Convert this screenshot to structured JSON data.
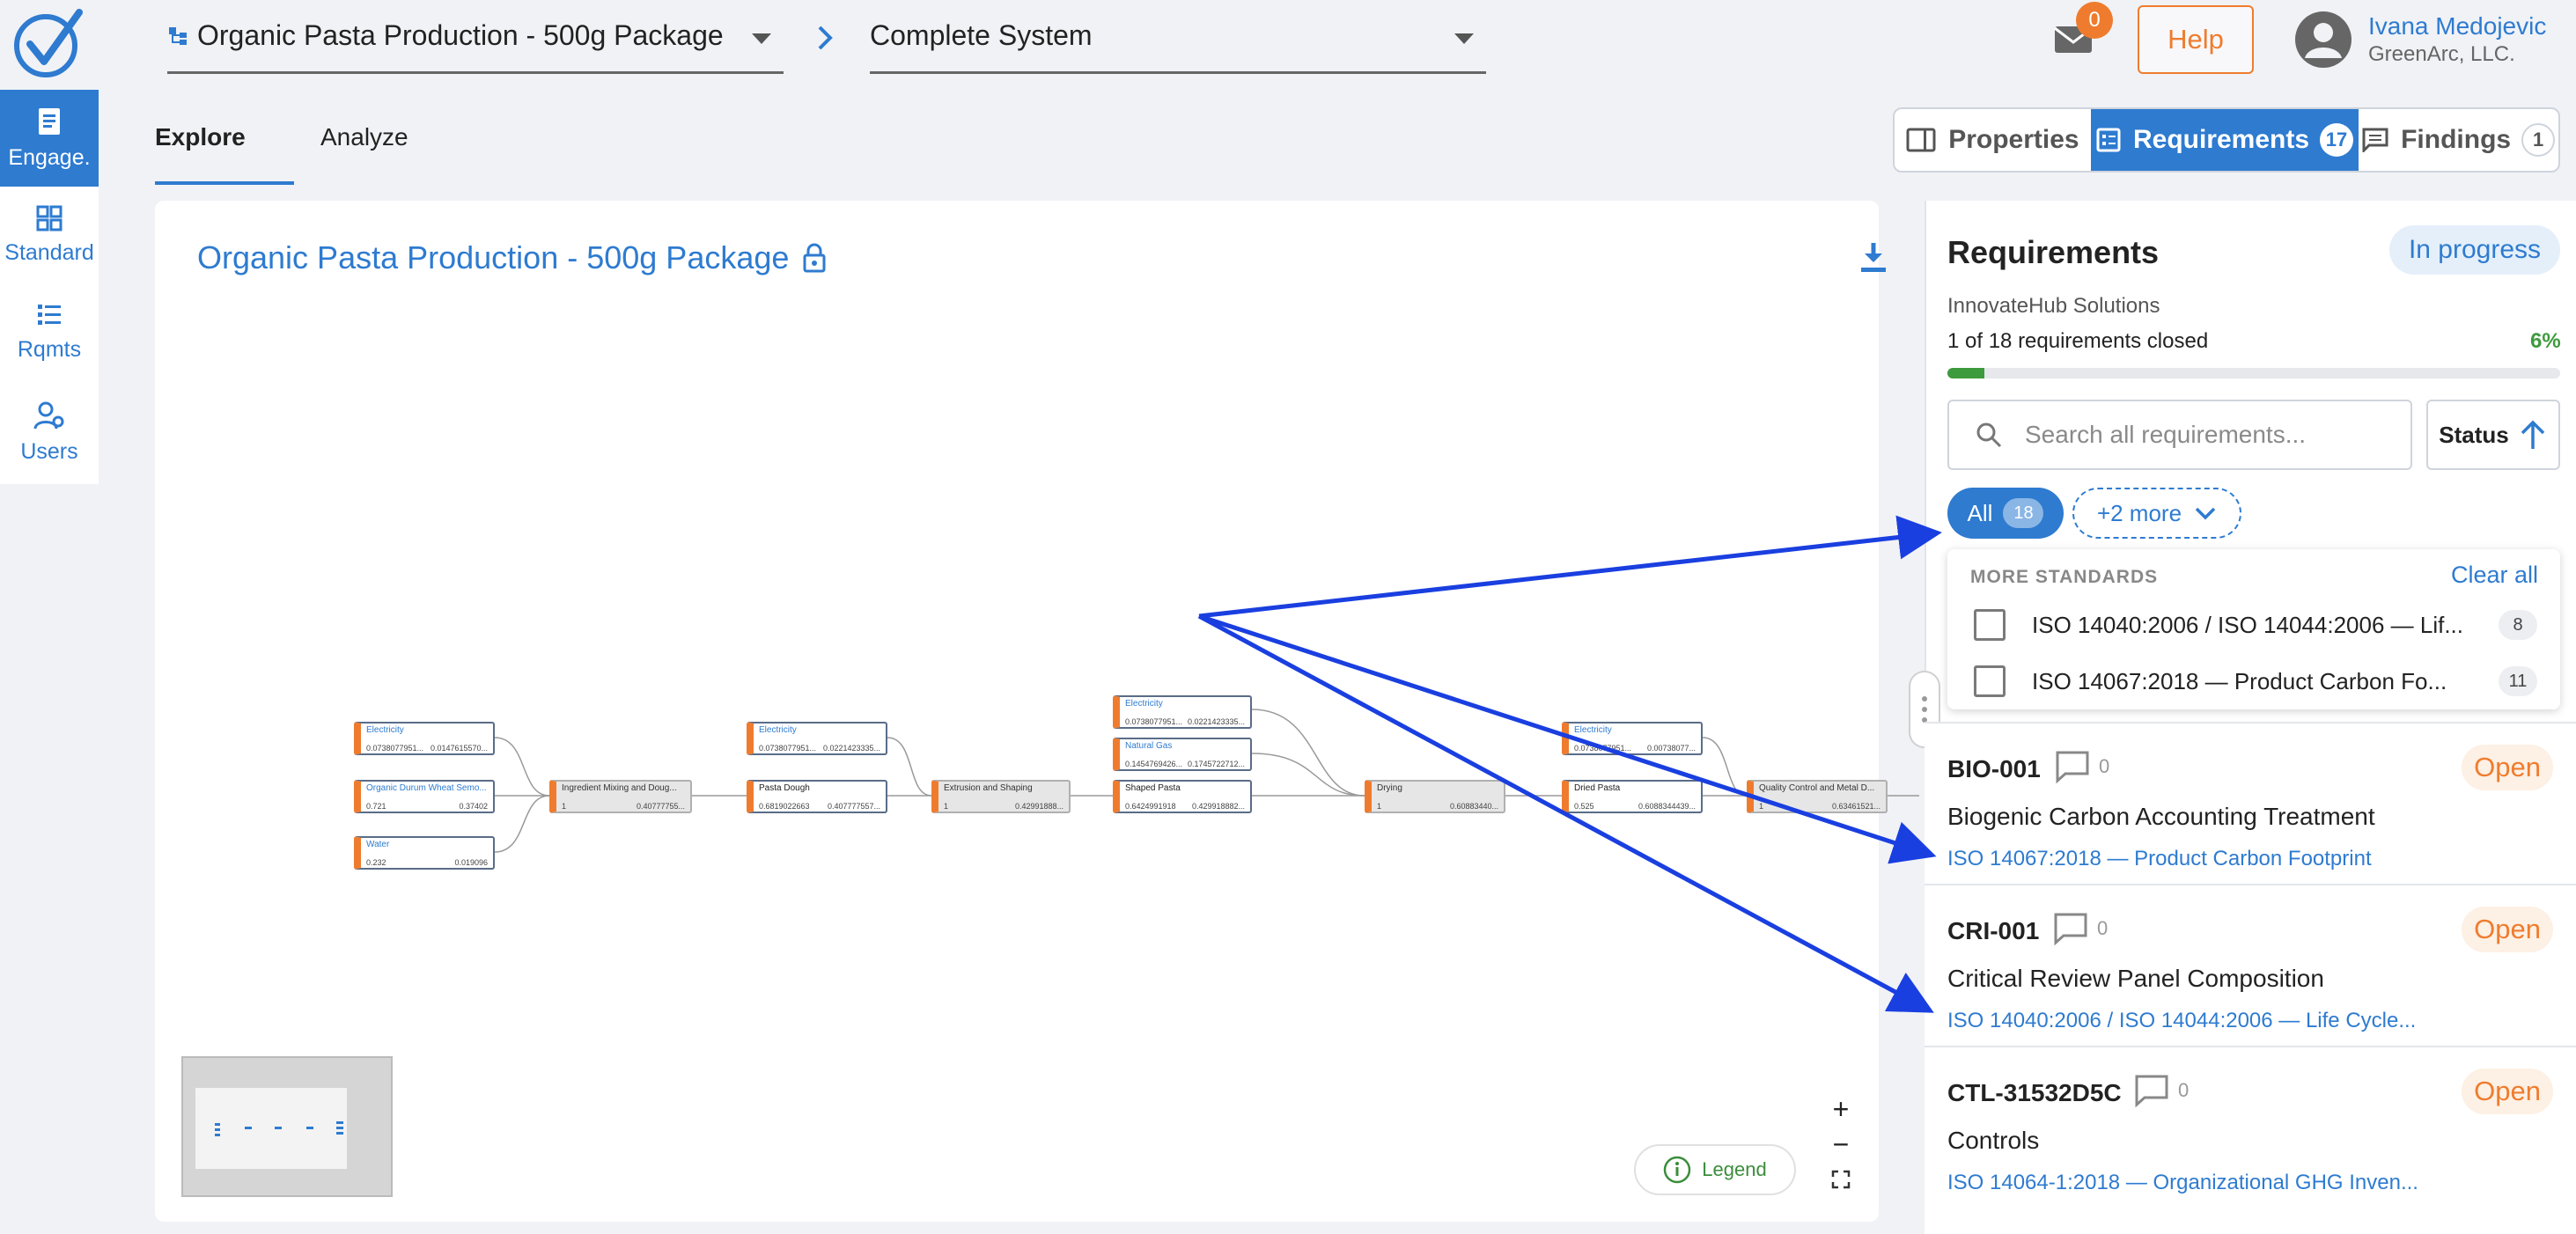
{
  "header": {
    "product_select": "Organic Pasta Production - 500g Package",
    "system_select": "Complete System",
    "mail_count": "0",
    "help": "Help",
    "user_name": "Ivana Medojevic",
    "user_org": "GreenArc, LLC."
  },
  "sidebar": {
    "items": [
      {
        "label": "Engage.",
        "icon": "document-icon"
      },
      {
        "label": "Standard",
        "icon": "grid-icon"
      },
      {
        "label": "Rqmts",
        "icon": "checklist-icon"
      },
      {
        "label": "Users",
        "icon": "users-gear-icon"
      }
    ]
  },
  "tabs": {
    "explore": "Explore",
    "analyze": "Analyze"
  },
  "panel_toggle": {
    "properties": "Properties",
    "requirements": "Requirements",
    "requirements_count": "17",
    "findings": "Findings",
    "findings_count": "1"
  },
  "canvas": {
    "title": "Organic Pasta Production - 500g Package",
    "legend": "Legend",
    "nodes": [
      {
        "name": "Electricity",
        "v1": "0.0738077951...",
        "v2": "0.0147615570..."
      },
      {
        "name": "Organic Durum Wheat Semo...",
        "v1": "0.721",
        "v2": "0.37402"
      },
      {
        "name": "Water",
        "v1": "0.232",
        "v2": "0.019096"
      },
      {
        "name": "Ingredient Mixing and Doug...",
        "v1": "1",
        "v2": "0.40777755..."
      },
      {
        "name": "Electricity",
        "v1": "0.0738077951...",
        "v2": "0.0221423335..."
      },
      {
        "name": "Pasta Dough",
        "v1": "0.6819022663",
        "v2": "0.407777557..."
      },
      {
        "name": "Extrusion and Shaping",
        "v1": "1",
        "v2": "0.42991888..."
      },
      {
        "name": "Electricity",
        "v1": "0.0738077951...",
        "v2": "0.0221423335..."
      },
      {
        "name": "Natural Gas",
        "v1": "0.1454769426...",
        "v2": "0.1745722712..."
      },
      {
        "name": "Shaped Pasta",
        "v1": "0.6424991918",
        "v2": "0.429918882..."
      },
      {
        "name": "Drying",
        "v1": "1",
        "v2": "0.60883440..."
      },
      {
        "name": "Electricity",
        "v1": "0.0738077951...",
        "v2": "0.00738077..."
      },
      {
        "name": "Dried Pasta",
        "v1": "0.525",
        "v2": "0.6088344439..."
      },
      {
        "name": "Quality Control and Metal D...",
        "v1": "1",
        "v2": "0.63461521..."
      }
    ]
  },
  "requirements": {
    "title": "Requirements",
    "status": "In progress",
    "org": "InnovateHub Solutions",
    "closed_text": "1 of 18 requirements closed",
    "percent_label": "6%",
    "progress": 0.06,
    "search_placeholder": "Search all requirements...",
    "sort_label": "Status",
    "chip_all": "All",
    "chip_all_count": "18",
    "chip_more": "+2 more",
    "dropdown": {
      "heading": "MORE STANDARDS",
      "clear": "Clear all",
      "options": [
        {
          "label": "ISO 14040:2006 / ISO 14044:2006 — Lif...",
          "count": "8"
        },
        {
          "label": "ISO 14067:2018 — Product Carbon Fo...",
          "count": "11"
        }
      ]
    },
    "items": [
      {
        "id": "BIO-001",
        "comments": "0",
        "status": "Open",
        "name": "Biogenic Carbon Accounting Treatment",
        "standard": "ISO 14067:2018 — Product Carbon Footprint"
      },
      {
        "id": "CRI-001",
        "comments": "0",
        "status": "Open",
        "name": "Critical Review Panel Composition",
        "standard": "ISO 14040:2006 / ISO 14044:2006 — Life Cycle..."
      },
      {
        "id": "CTL-31532D5C",
        "comments": "0",
        "status": "Open",
        "name": "Controls",
        "standard": "ISO 14064-1:2018 — Organizational GHG Inven..."
      }
    ]
  },
  "colors": {
    "accent": "#2e7bd0",
    "orange": "#ef7c2e",
    "green": "#3d9a3d",
    "annotation_arrow": "#1a3fe0"
  }
}
